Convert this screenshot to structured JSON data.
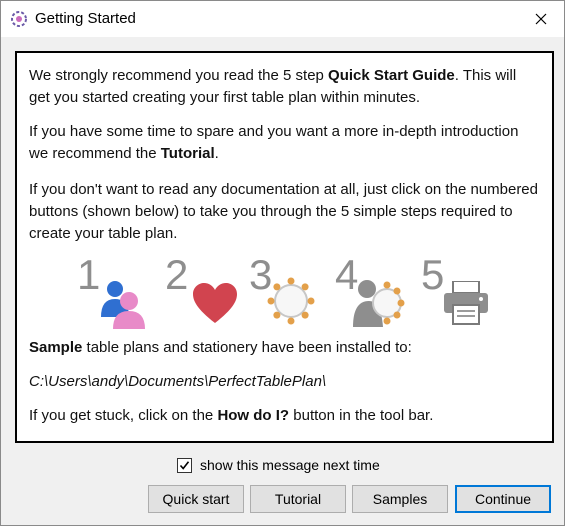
{
  "window": {
    "title": "Getting Started"
  },
  "content": {
    "p1": {
      "pre": "We strongly recommend you read the 5 step ",
      "bold": "Quick Start Guide",
      "post": ". This will get you started creating your first table plan within minutes."
    },
    "p2": {
      "pre": "If you have some time to spare and you want a more in-depth introduction we recommend the ",
      "bold": "Tutorial",
      "post": "."
    },
    "p3": "If you don't want to read any documentation at all, just click on the numbered buttons (shown below) to take you through the 5 simple steps required to create your table plan.",
    "steps": [
      {
        "number": "1",
        "icon": "people-icon"
      },
      {
        "number": "2",
        "icon": "heart-icon"
      },
      {
        "number": "3",
        "icon": "table-icon"
      },
      {
        "number": "4",
        "icon": "seated-person-icon"
      },
      {
        "number": "5",
        "icon": "printer-icon"
      }
    ],
    "p4": {
      "bold": "Sample",
      "post": " table plans and stationery have been installed to:"
    },
    "path": "C:\\Users\\andy\\Documents\\PerfectTablePlan\\",
    "p5": {
      "pre": "If you get stuck, click on the ",
      "bold": "How do I?",
      "post": " button in the tool bar."
    }
  },
  "checkbox": {
    "label": "show this message next time",
    "checked": true
  },
  "buttons": {
    "quick_start": "Quick start",
    "tutorial": "Tutorial",
    "samples": "Samples",
    "continue": "Continue"
  },
  "colors": {
    "accent": "#0078d7",
    "step_number": "#8e8e8e",
    "person_blue": "#2f6fd1",
    "person_pink": "#e88ac8",
    "heart_red": "#d1444f",
    "table_orange": "#e3a04a",
    "seated_gray": "#8e8e8e"
  }
}
